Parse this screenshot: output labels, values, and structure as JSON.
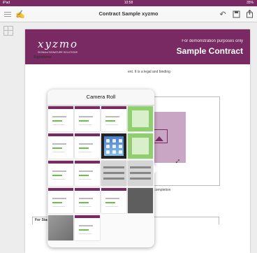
{
  "status_bar": {
    "device": "iPad",
    "time": "10:58",
    "battery": "35%"
  },
  "nav": {
    "title": "Contract Sample xyzmo",
    "icons": [
      "menu-icon",
      "sign-icon",
      "undo-icon",
      "save-icon",
      "share-icon"
    ]
  },
  "document": {
    "brand": "xyzmo",
    "tagline": "SIGNiAnt SIGNATURE SOLUTIONS",
    "demo_note": "For demonstration purposes only",
    "title": "Sample Contract",
    "signatures_heading": "Signatures",
    "body_text": "ent. It is a legal and binding",
    "option_text": "tional 50% upon completion",
    "stage_label": "For Stage Right Now"
  },
  "camera_roll": {
    "title": "Camera Roll",
    "thumbnails": [
      "doc",
      "doc",
      "doc",
      "green",
      "doc",
      "doc",
      "ipad",
      "green",
      "doc",
      "doc",
      "keyboard",
      "keyboard",
      "doc",
      "doc",
      "doc",
      "dark",
      "photo",
      "doc"
    ]
  },
  "colors": {
    "brand": "#7a2a63",
    "accent_green": "#6dbf4b",
    "image_placeholder": "#c9a6c3"
  }
}
